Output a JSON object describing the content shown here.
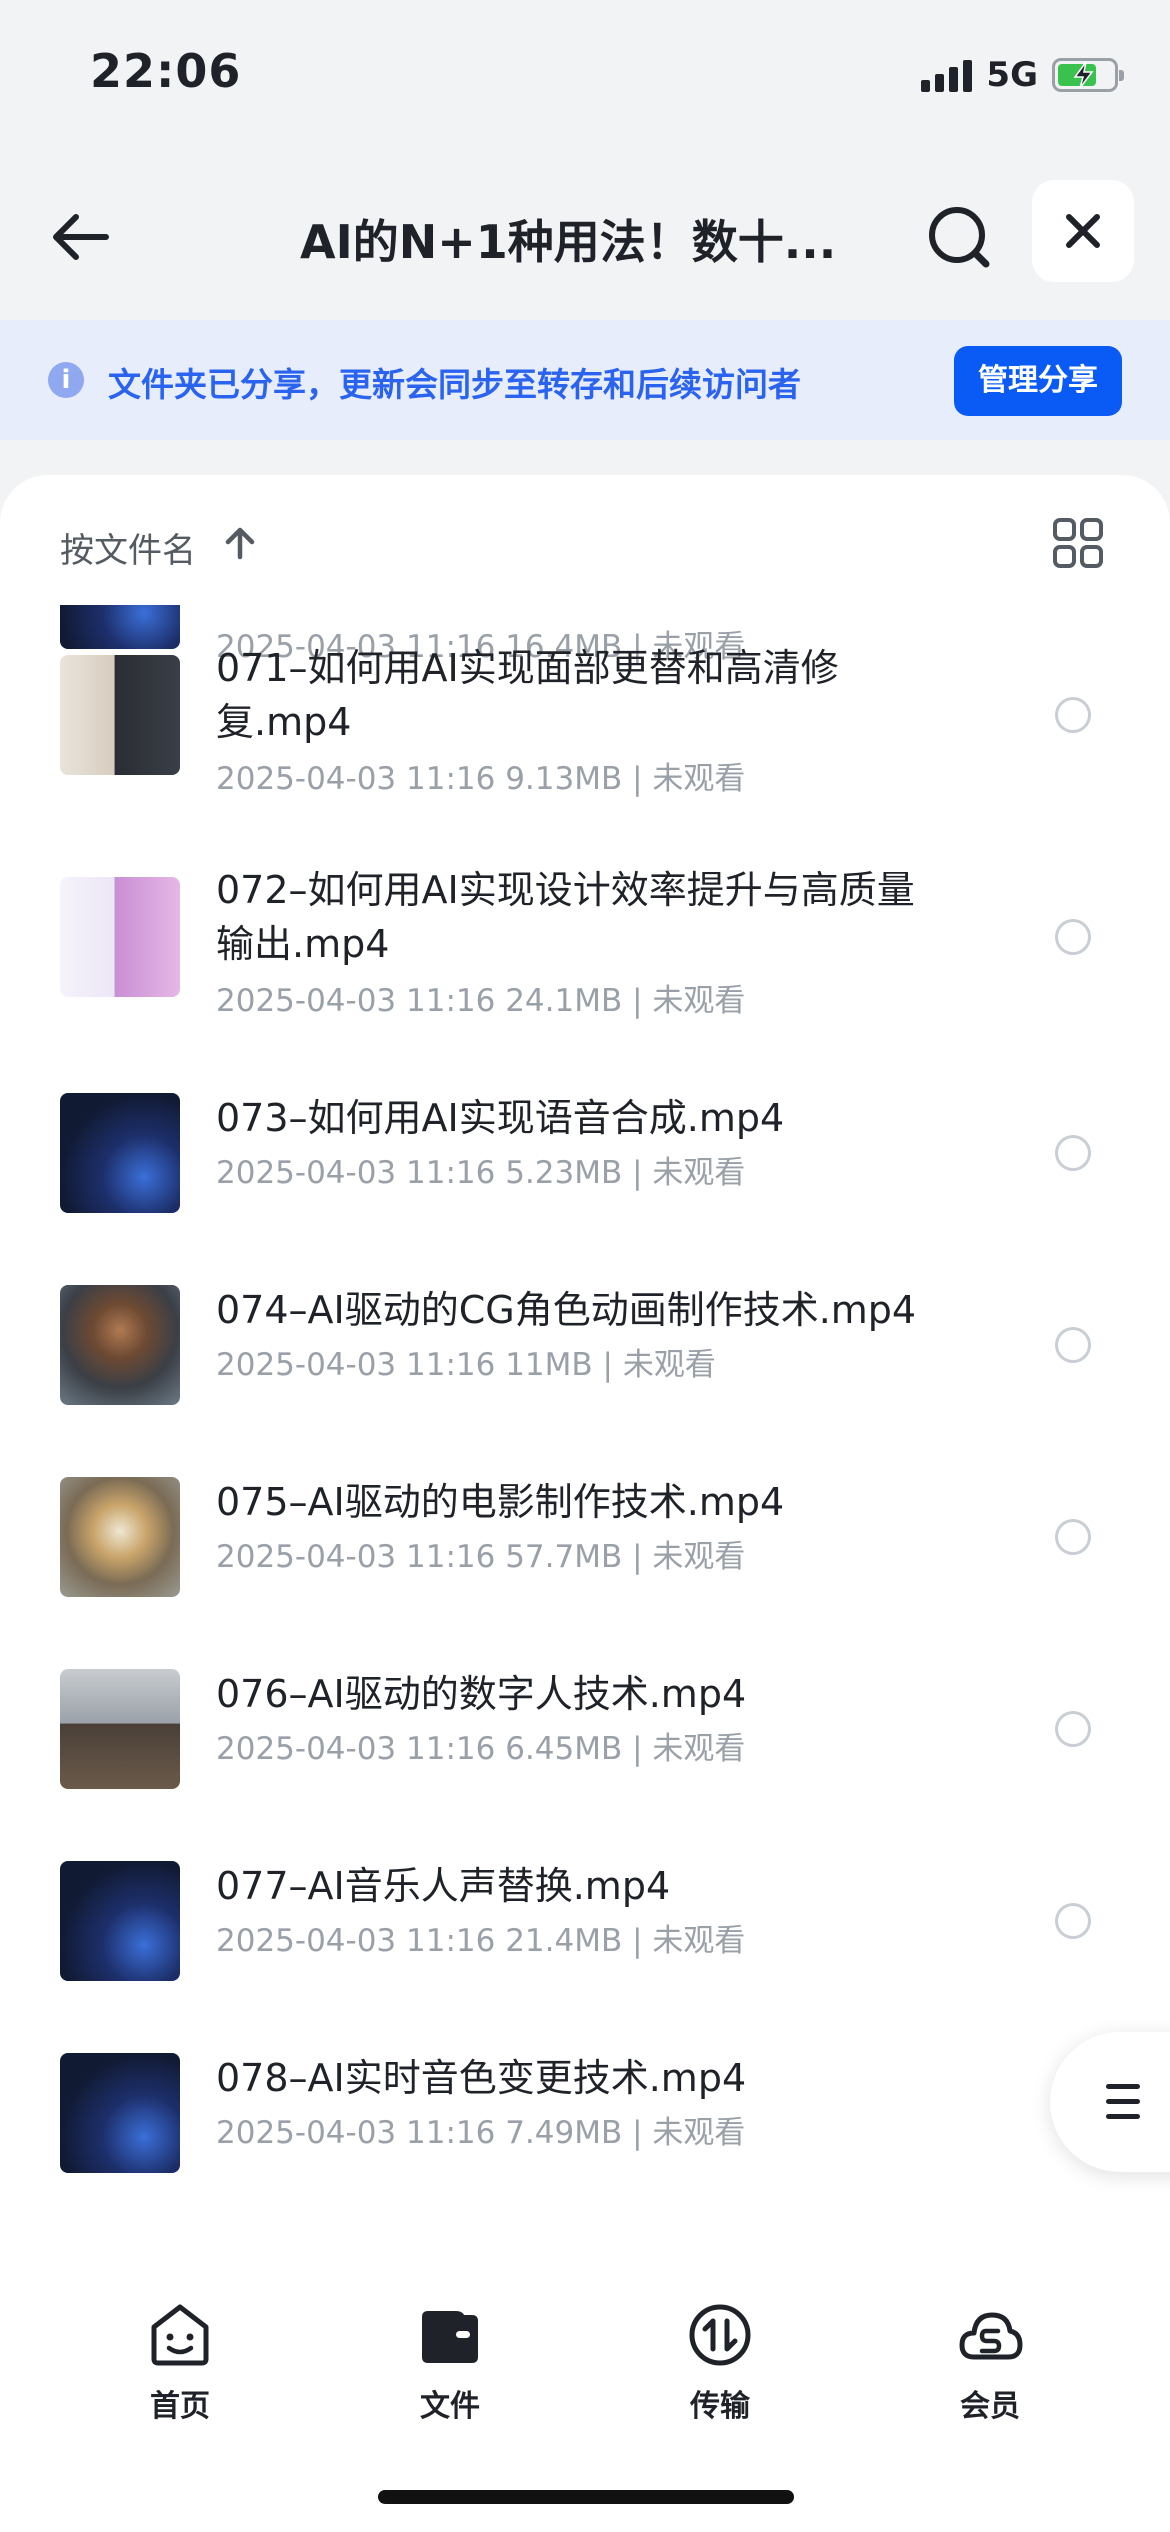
{
  "status_bar": {
    "time": "22:06",
    "network": "5G"
  },
  "nav": {
    "title": "AI的N+1种用法！数十..."
  },
  "banner": {
    "info_glyph": "i",
    "text": "文件夹已分享，更新会同步至转存和后续访问者",
    "manage_label": "管理分享"
  },
  "sort": {
    "label": "按文件名"
  },
  "files": [
    {
      "name": "",
      "meta": "2025-04-03 11:16  16.4MB | 未观看",
      "thumb": "tech"
    },
    {
      "name": "071–如何用AI实现面部更替和高清修复.mp4",
      "meta": "2025-04-03 11:16  9.13MB | 未观看",
      "thumb": "face"
    },
    {
      "name": "072–如何用AI实现设计效率提升与高质量输出.mp4",
      "meta": "2025-04-03 11:16  24.1MB | 未观看",
      "thumb": "design"
    },
    {
      "name": "073–如何用AI实现语音合成.mp4",
      "meta": "2025-04-03 11:16  5.23MB | 未观看",
      "thumb": "tech"
    },
    {
      "name": "074–AI驱动的CG角色动画制作技术.mp4",
      "meta": "2025-04-03 11:16  11MB | 未观看",
      "thumb": "cg"
    },
    {
      "name": "075–AI驱动的电影制作技术.mp4",
      "meta": "2025-04-03 11:16  57.7MB | 未观看",
      "thumb": "clown"
    },
    {
      "name": "076–AI驱动的数字人技术.mp4",
      "meta": "2025-04-03 11:16  6.45MB | 未观看",
      "thumb": "office"
    },
    {
      "name": "077–AI音乐人声替换.mp4",
      "meta": "2025-04-03 11:16  21.4MB | 未观看",
      "thumb": "tech"
    },
    {
      "name": "078–AI实时音色变更技术.mp4",
      "meta": "2025-04-03 11:16  7.49MB | 未观看",
      "thumb": "tech"
    }
  ],
  "tabs": [
    {
      "label": "首页",
      "icon": "home-face-icon"
    },
    {
      "label": "文件",
      "icon": "folder-icon"
    },
    {
      "label": "传输",
      "icon": "transfer-icon"
    },
    {
      "label": "会员",
      "icon": "vip-cloud-icon"
    }
  ],
  "colors": {
    "accent": "#0a5bf5",
    "banner_bg": "#e8edfb",
    "banner_text": "#2a63f0"
  }
}
